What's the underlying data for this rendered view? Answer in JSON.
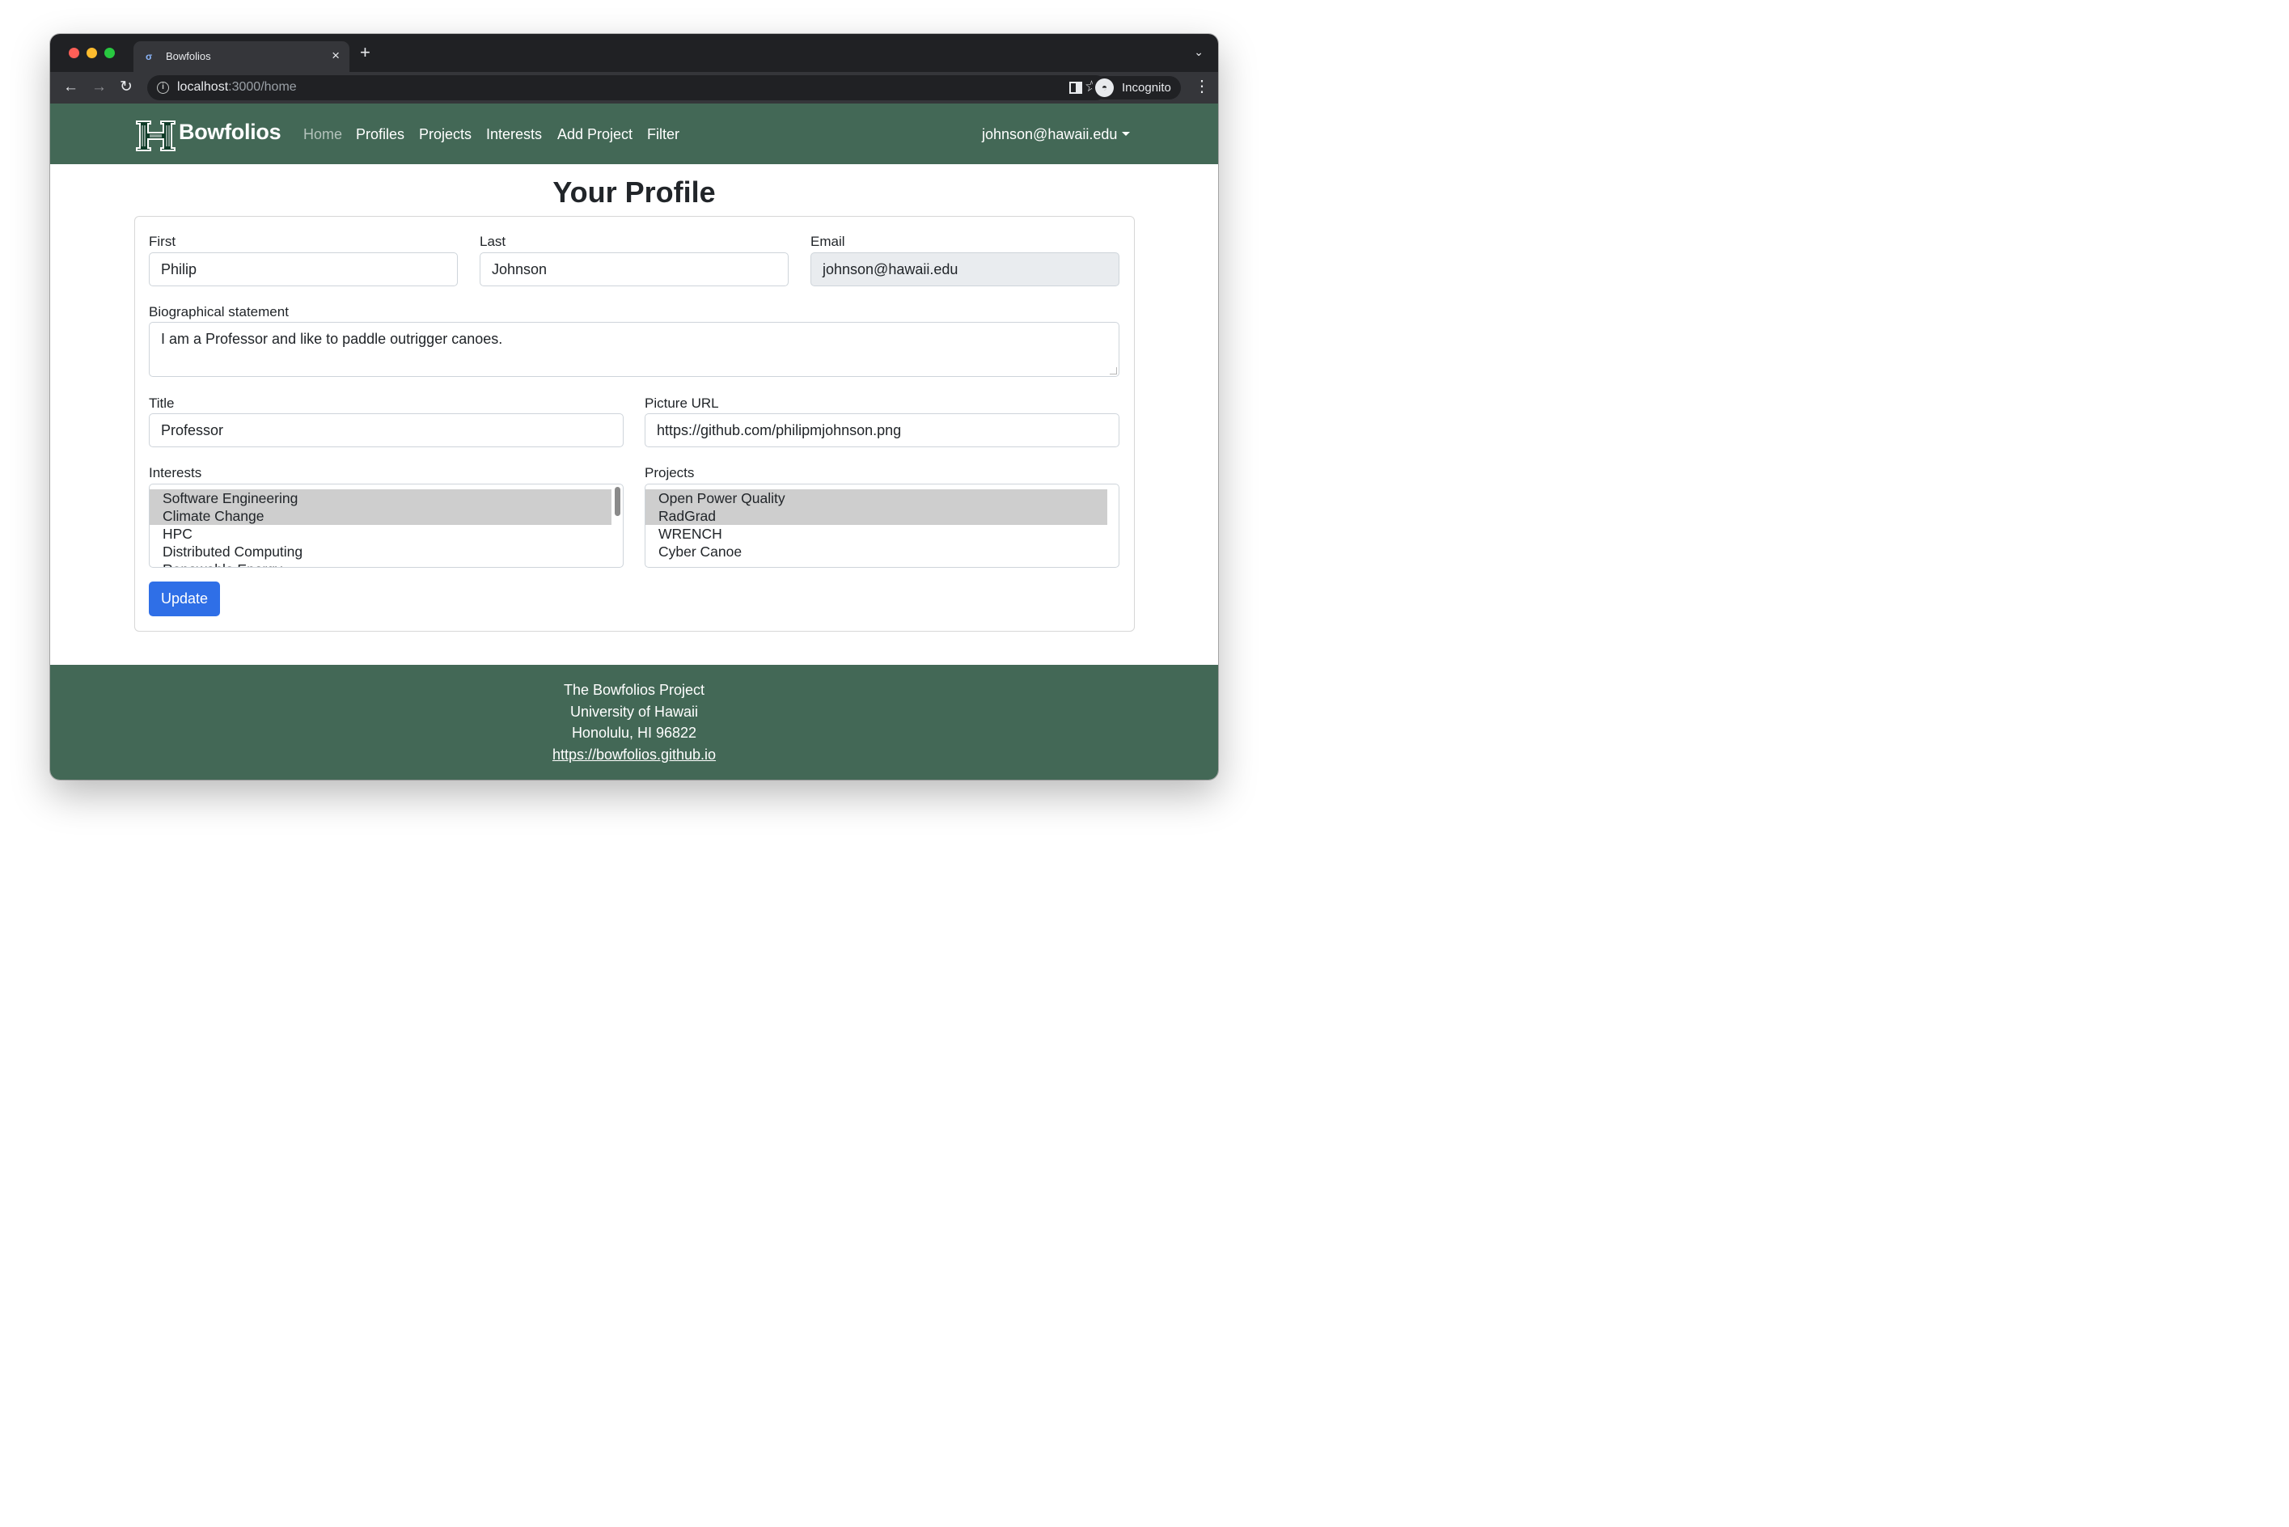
{
  "browser": {
    "tab_title": "Bowfolios",
    "url_host": "localhost",
    "url_rest": ":3000/home",
    "profile_label": "Incognito"
  },
  "navbar": {
    "brand": "Bowfolios",
    "links": [
      "Home",
      "Profiles",
      "Projects",
      "Interests",
      "Add Project",
      "Filter"
    ],
    "user": "johnson@hawaii.edu"
  },
  "page": {
    "title": "Your Profile"
  },
  "form": {
    "first_label": "First",
    "first_value": "Philip",
    "last_label": "Last",
    "last_value": "Johnson",
    "email_label": "Email",
    "email_value": "johnson@hawaii.edu",
    "bio_label": "Biographical statement",
    "bio_value": "I am a Professor and like to paddle outrigger canoes.",
    "title_label": "Title",
    "title_value": "Professor",
    "picture_label": "Picture URL",
    "picture_value": "https://github.com/philipmjohnson.png",
    "interests_label": "Interests",
    "interests": [
      {
        "label": "Software Engineering",
        "selected": true
      },
      {
        "label": "Climate Change",
        "selected": true
      },
      {
        "label": "HPC",
        "selected": false
      },
      {
        "label": "Distributed Computing",
        "selected": false
      },
      {
        "label": "Renewable Energy",
        "selected": false
      }
    ],
    "projects_label": "Projects",
    "projects": [
      {
        "label": "Open Power Quality",
        "selected": true
      },
      {
        "label": "RadGrad",
        "selected": true
      },
      {
        "label": "WRENCH",
        "selected": false
      },
      {
        "label": "Cyber Canoe",
        "selected": false
      }
    ],
    "submit_label": "Update"
  },
  "footer": {
    "line1": "The Bowfolios Project",
    "line2": "University of Hawaii",
    "line3": "Honolulu, HI 96822",
    "link": "https://bowfolios.github.io"
  }
}
